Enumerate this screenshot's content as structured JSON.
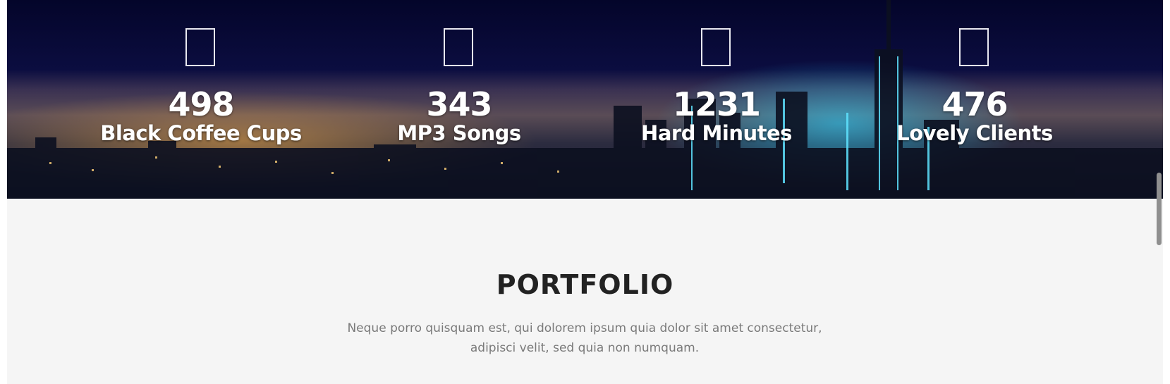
{
  "stats": {
    "items": [
      {
        "value": "498",
        "label": "Black Coffee Cups",
        "icon": "broken-icon-glyph"
      },
      {
        "value": "343",
        "label": "MP3 Songs",
        "icon": "broken-icon-glyph"
      },
      {
        "value": "1231",
        "label": "Hard Minutes",
        "icon": "broken-icon-glyph"
      },
      {
        "value": "476",
        "label": "Lovely Clients",
        "icon": "broken-icon-glyph"
      }
    ]
  },
  "portfolio": {
    "title": "PORTFOLIO",
    "description_line1": "Neque porro quisquam est, qui dolorem ipsum quia dolor sit amet consectetur,",
    "description_line2": "adipisci velit, sed quia non numquam."
  },
  "colors": {
    "section_bg": "#f5f5f5",
    "title": "#222222",
    "description": "#7a7a7a",
    "stat_text": "#ffffff"
  }
}
